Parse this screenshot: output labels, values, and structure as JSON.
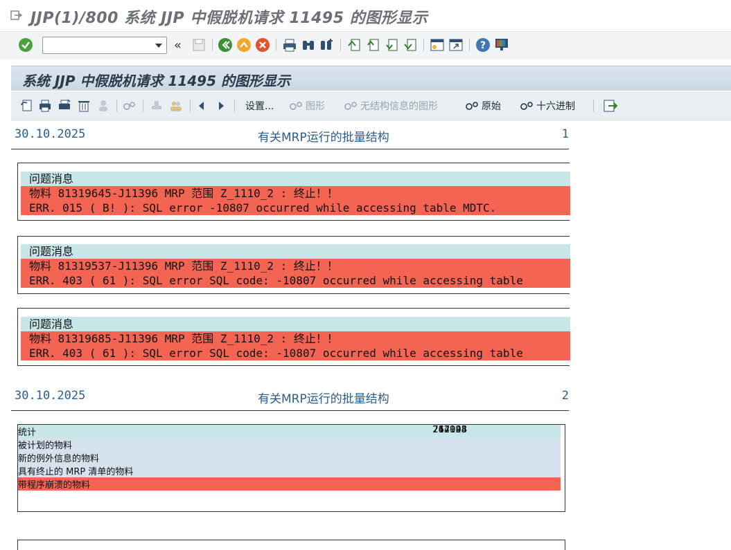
{
  "window": {
    "title": "JJP(1)/800 系统 JJP 中假脱机请求 11495 的图形显示"
  },
  "command_field": {
    "value": "",
    "placeholder": ""
  },
  "screen": {
    "subtitle": "系统 JJP 中假脱机请求 11495 的图形显示"
  },
  "app_toolbar": {
    "settings": "设置...",
    "graphics": "图形",
    "unstructured": "无结构信息的图形",
    "raw": "原始",
    "hex": "十六进制"
  },
  "pages": [
    {
      "date": "30.10.2025",
      "title": "有关MRP运行的批量结构",
      "page": "1"
    },
    {
      "date": "30.10.2025",
      "title": "有关MRP运行的批量结构",
      "page": "2"
    }
  ],
  "problem_blocks": [
    {
      "caption": "问题消息",
      "line1": "物料 81319645-J11396 MRP 范围 Z_1110_2 : 终止！！",
      "line2": "ERR. 015 ( B! ): SQL error -10807 occurred while accessing table MDTC."
    },
    {
      "caption": "问题消息",
      "line1": "物料 81319537-J11396 MRP 范围 Z_1110_2 : 终止！！",
      "line2": "ERR. 403 ( 61 ): SQL error SQL code: -10807 occurred while accessing table"
    },
    {
      "caption": "问题消息",
      "line1": "物料 81319685-J11396 MRP 范围 Z_1110_2 : 终止！！",
      "line2": "ERR. 403 ( 61 ): SQL error SQL code: -10807 occurred while accessing table"
    }
  ],
  "statistics": {
    "caption": "统计",
    "rows": [
      {
        "label": "被计划的物料",
        "value": "717048"
      },
      {
        "label": "新的例外信息的物料",
        "value": "262924"
      },
      {
        "label": "具有终止的 MRP 清单的物料",
        "value": "244193"
      },
      {
        "label": "带程序崩溃的物料",
        "value": "3"
      }
    ]
  },
  "colors": {
    "caption_bg": "#c6e6e8",
    "error_bg": "#f46452",
    "stat_bg": "#d6e1ee",
    "header_text": "#2a5d8f"
  }
}
